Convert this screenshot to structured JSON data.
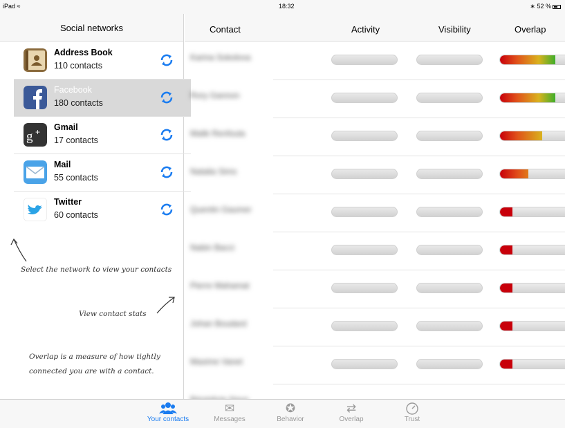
{
  "status_bar": {
    "carrier": "iPad",
    "time": "18:32",
    "battery": "52 %"
  },
  "sidebar": {
    "title": "Social networks",
    "networks": [
      {
        "name": "Address Book",
        "count": "110 contacts",
        "icon": "address-book-icon",
        "selected": false
      },
      {
        "name": "Facebook",
        "count": "180 contacts",
        "icon": "facebook-icon",
        "selected": true
      },
      {
        "name": "Gmail",
        "count": "17 contacts",
        "icon": "google-plus-icon",
        "selected": false
      },
      {
        "name": "Mail",
        "count": "55 contacts",
        "icon": "mail-icon",
        "selected": false
      },
      {
        "name": "Twitter",
        "count": "60 contacts",
        "icon": "twitter-icon",
        "selected": false
      }
    ],
    "hints": {
      "select_network": "Select the network to view your contacts",
      "view_stats": "View contact stats",
      "overlap_line1": "Overlap is a measure of how tightly",
      "overlap_line2": "connected you are with a contact."
    }
  },
  "table": {
    "columns": {
      "contact": "Contact",
      "activity": "Activity",
      "visibility": "Visibility",
      "overlap": "Overlap"
    },
    "rows": [
      {
        "contact": "Karina Sokolova",
        "overlap": 0.82
      },
      {
        "contact": "Rory Gannon",
        "overlap": 0.82
      },
      {
        "contact": "Malik Renfoula",
        "overlap": 0.62
      },
      {
        "contact": "Natalia Sims",
        "overlap": 0.42
      },
      {
        "contact": "Quentin Gaumer",
        "overlap": 0.18
      },
      {
        "contact": "Nabin Bacci",
        "overlap": 0.18
      },
      {
        "contact": "Pierre Mahamat",
        "overlap": 0.18
      },
      {
        "contact": "Johan Boudard",
        "overlap": 0.18
      },
      {
        "contact": "Maxime Vanet",
        "overlap": 0.18
      },
      {
        "contact": "Bénédicte Nave",
        "overlap": null
      }
    ]
  },
  "tabbar": {
    "tabs": [
      {
        "label": "Your contacts",
        "icon": "people-icon",
        "active": true
      },
      {
        "label": "Messages",
        "icon": "envelope-icon",
        "active": false
      },
      {
        "label": "Behavior",
        "icon": "runner-icon",
        "active": false
      },
      {
        "label": "Overlap",
        "icon": "shuffle-icon",
        "active": false
      },
      {
        "label": "Trust",
        "icon": "gauge-icon",
        "active": false
      }
    ]
  },
  "colors": {
    "accent": "#1a7cf0",
    "overlap_start": "#c8000a",
    "overlap_end": "#3fae2a"
  }
}
